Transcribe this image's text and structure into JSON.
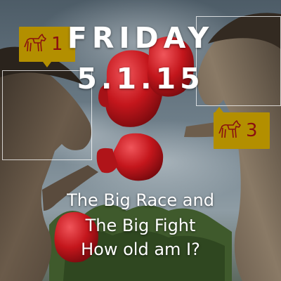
{
  "title": {
    "day": "FRIDAY",
    "date": "5.1.15"
  },
  "caption": {
    "line1": "The Big Race and",
    "line2": "The Big Fight",
    "line3": "How old am I?"
  },
  "badges": [
    {
      "icon": "horse-icon",
      "number": "1"
    },
    {
      "icon": "horse-icon",
      "number": "3"
    }
  ],
  "colors": {
    "badge_fill": "#b38f00",
    "badge_ink": "#8a1010",
    "headline_text": "#ffffff",
    "glove_red": "#c4161c"
  }
}
